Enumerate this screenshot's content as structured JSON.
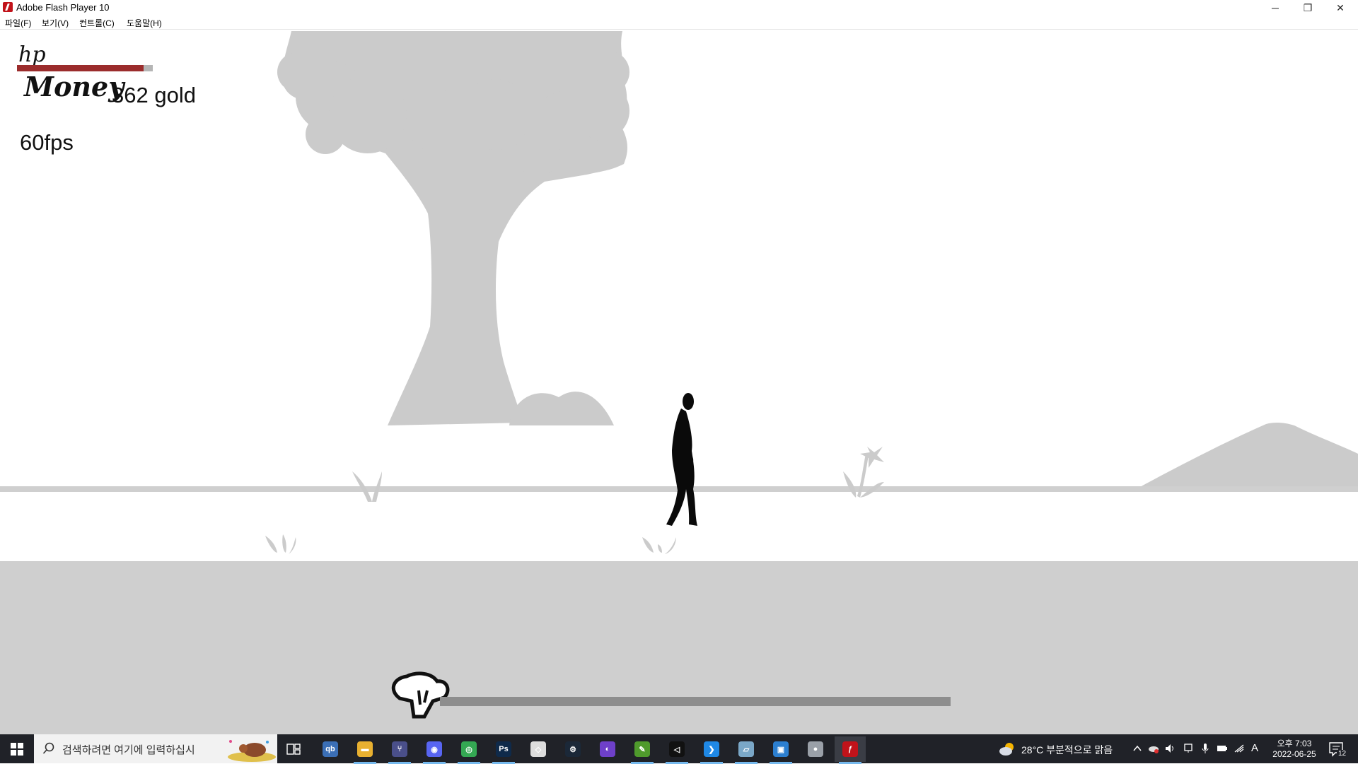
{
  "window": {
    "title": "Adobe Flash Player 10",
    "minimize_glyph": "─",
    "restore_glyph": "❐",
    "close_glyph": "✕"
  },
  "menu": {
    "file": "파일(F)",
    "view": "보기(V)",
    "control": "컨트롤(C)",
    "help": "도움말(H)"
  },
  "hud": {
    "hp_label": "hp",
    "hp_fraction": 0.93,
    "money_label": "Money",
    "money_value": "362 gold",
    "fps": "60fps",
    "progress_fraction": 1.0
  },
  "colors": {
    "scenery": "#cbcbcb",
    "ground": "#cfcfcf",
    "hp_fill": "#9b2c2c",
    "hp_track": "#b5b5b5",
    "progress_bar": "#8e8e8e",
    "taskbar": "#202228"
  },
  "taskbar": {
    "search_placeholder": "검색하려면 여기에 입력하십시",
    "apps": [
      {
        "name": "qbittorrent-icon",
        "glyph": "qb",
        "color": "#3b6fb6",
        "active": false,
        "running": false
      },
      {
        "name": "file-explorer-icon",
        "glyph": "▬",
        "color": "#e8b030",
        "active": false,
        "running": true
      },
      {
        "name": "git-fork-icon",
        "glyph": "⑂",
        "color": "#4a4f8a",
        "active": false,
        "running": true
      },
      {
        "name": "discord-icon",
        "glyph": "◉",
        "color": "#5865f2",
        "active": false,
        "running": true
      },
      {
        "name": "chrome-icon",
        "glyph": "◎",
        "color": "#34a853",
        "active": false,
        "running": true
      },
      {
        "name": "photoshop-icon",
        "glyph": "Ps",
        "color": "#0f2a4a",
        "active": false,
        "running": true
      },
      {
        "name": "unity-icon",
        "glyph": "◇",
        "color": "#dddddd",
        "active": false,
        "running": false
      },
      {
        "name": "steam-icon",
        "glyph": "⚙",
        "color": "#1b2838",
        "active": false,
        "running": false
      },
      {
        "name": "github-desktop-icon",
        "glyph": "◐",
        "color": "#6e40c9",
        "active": false,
        "running": false
      },
      {
        "name": "notepad-plus-icon",
        "glyph": "✎",
        "color": "#4f9a2c",
        "active": false,
        "running": true
      },
      {
        "name": "unity-hub-icon",
        "glyph": "◁",
        "color": "#111111",
        "active": false,
        "running": true
      },
      {
        "name": "vscode-icon",
        "glyph": "❯",
        "color": "#1f88e5",
        "active": false,
        "running": true
      },
      {
        "name": "editor-icon",
        "glyph": "▱",
        "color": "#7aa7c7",
        "active": false,
        "running": true
      },
      {
        "name": "remote-desktop-icon",
        "glyph": "▣",
        "color": "#2c7fd0",
        "active": false,
        "running": true
      },
      {
        "name": "mouse-app-icon",
        "glyph": "●",
        "color": "#9aa0a8",
        "active": false,
        "running": false
      },
      {
        "name": "flash-player-icon",
        "glyph": "ƒ",
        "color": "#c1131a",
        "active": true,
        "running": true
      }
    ],
    "weather": "28°C  부분적으로 맑음",
    "ime": "A",
    "time": "오후 7:03",
    "date": "2022-06-25",
    "notifications": "12"
  }
}
